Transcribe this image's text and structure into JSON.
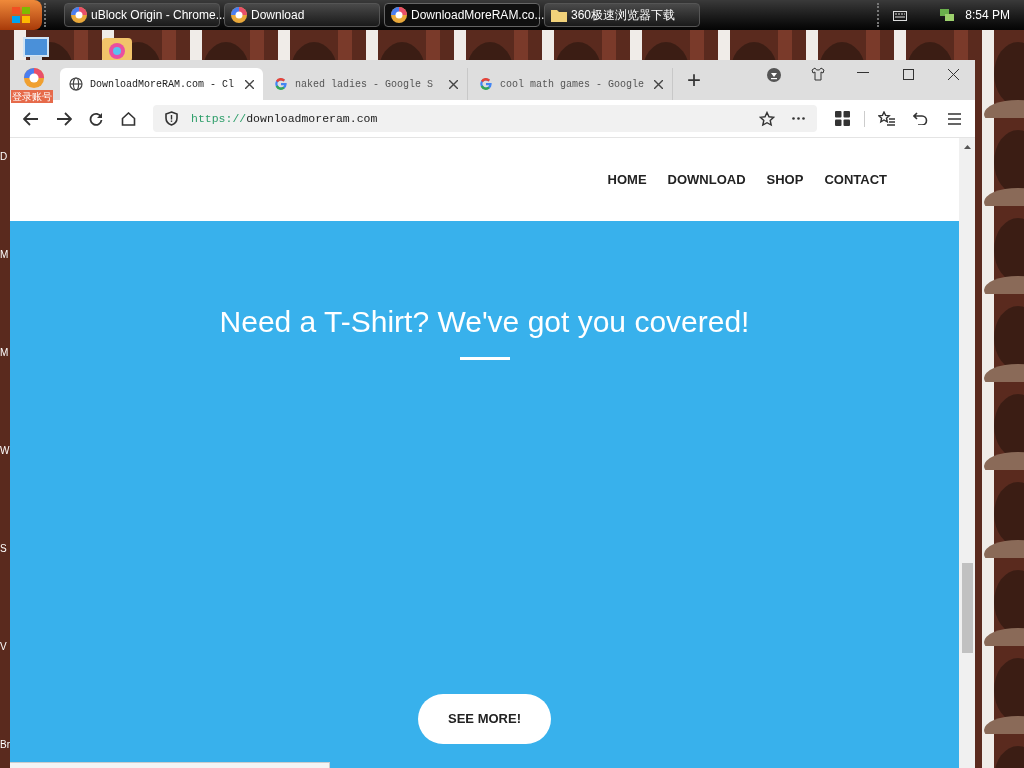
{
  "taskbar": {
    "tasks": [
      {
        "label": "uBlock Origin - Chrome...",
        "kind": "browser",
        "selected": false
      },
      {
        "label": "Download",
        "kind": "browser",
        "selected": false
      },
      {
        "label": "DownloadMoreRAM.co...",
        "kind": "browser",
        "selected": true
      },
      {
        "label": "360极速浏览器下载",
        "kind": "folder",
        "selected": false
      }
    ],
    "clock": "8:54 PM"
  },
  "desktop": {
    "icon_labels": [
      "D",
      "M",
      "M",
      "W",
      "S",
      "V",
      "Br"
    ]
  },
  "browser": {
    "account_badge": "登录账号",
    "tabs": [
      {
        "label": "DownloadMoreRAM.com - Cl",
        "kind": "site",
        "selected": true
      },
      {
        "label": "naked ladies - Google S",
        "kind": "search",
        "selected": false
      },
      {
        "label": "cool math games - Google",
        "kind": "search",
        "selected": false
      }
    ],
    "new_tab": "+",
    "address": {
      "scheme": "https://",
      "host": "downloadmoreram.com"
    }
  },
  "page": {
    "nav": [
      "HOME",
      "DOWNLOAD",
      "SHOP",
      "CONTACT"
    ],
    "heading": "Need a T-Shirt? We've got you covered!",
    "button": "SEE MORE!"
  }
}
